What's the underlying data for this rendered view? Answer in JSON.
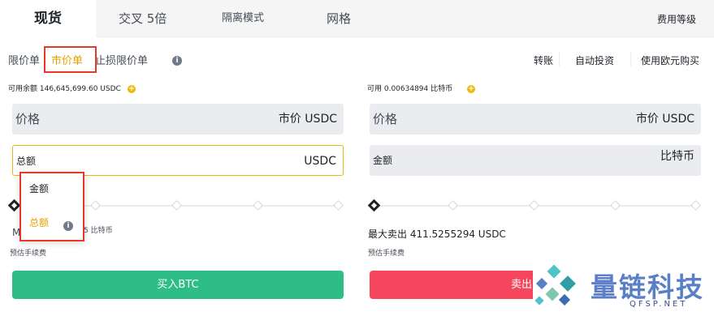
{
  "tabs": {
    "spot": "现货",
    "cross": "交叉 5倍",
    "isolated": "隔离模式",
    "grid": "网格",
    "fee_level": "费用等级"
  },
  "order_types": {
    "limit": "限价单",
    "market": "市价单",
    "stop_limit": "止损限价单",
    "info": "i"
  },
  "right_links": {
    "transfer": "转账",
    "auto_invest": "自动投资",
    "buy_eur": "使用欧元购买"
  },
  "buy": {
    "available": "可用余额 146,645,699.60 USDC",
    "price_label": "价格",
    "price_value": "市价 USDC",
    "total_label": "总额",
    "total_unit": "USDC",
    "partial_text": "5 比特币",
    "fee_est": "预估手续费",
    "button": "买入BTC",
    "max_prefix": "M"
  },
  "sell": {
    "available": "可用 0.00634894 比特币",
    "price_label": "价格",
    "price_value": "市价 USDC",
    "amount_label": "金额",
    "amount_unit": "比特币",
    "max_sell": "最大卖出 411.5255294 USDC",
    "fee_est": "预估手续费",
    "button": "卖出"
  },
  "dropdown": {
    "items": [
      "金额",
      "总额"
    ],
    "selected": "总额"
  },
  "watermark": {
    "name": "量链科技",
    "site": "QFSP.NET"
  },
  "colors": {
    "accent": "#e8a100",
    "buy": "#2ebd85",
    "sell": "#f6465d",
    "highlight_box": "#e4392b"
  }
}
